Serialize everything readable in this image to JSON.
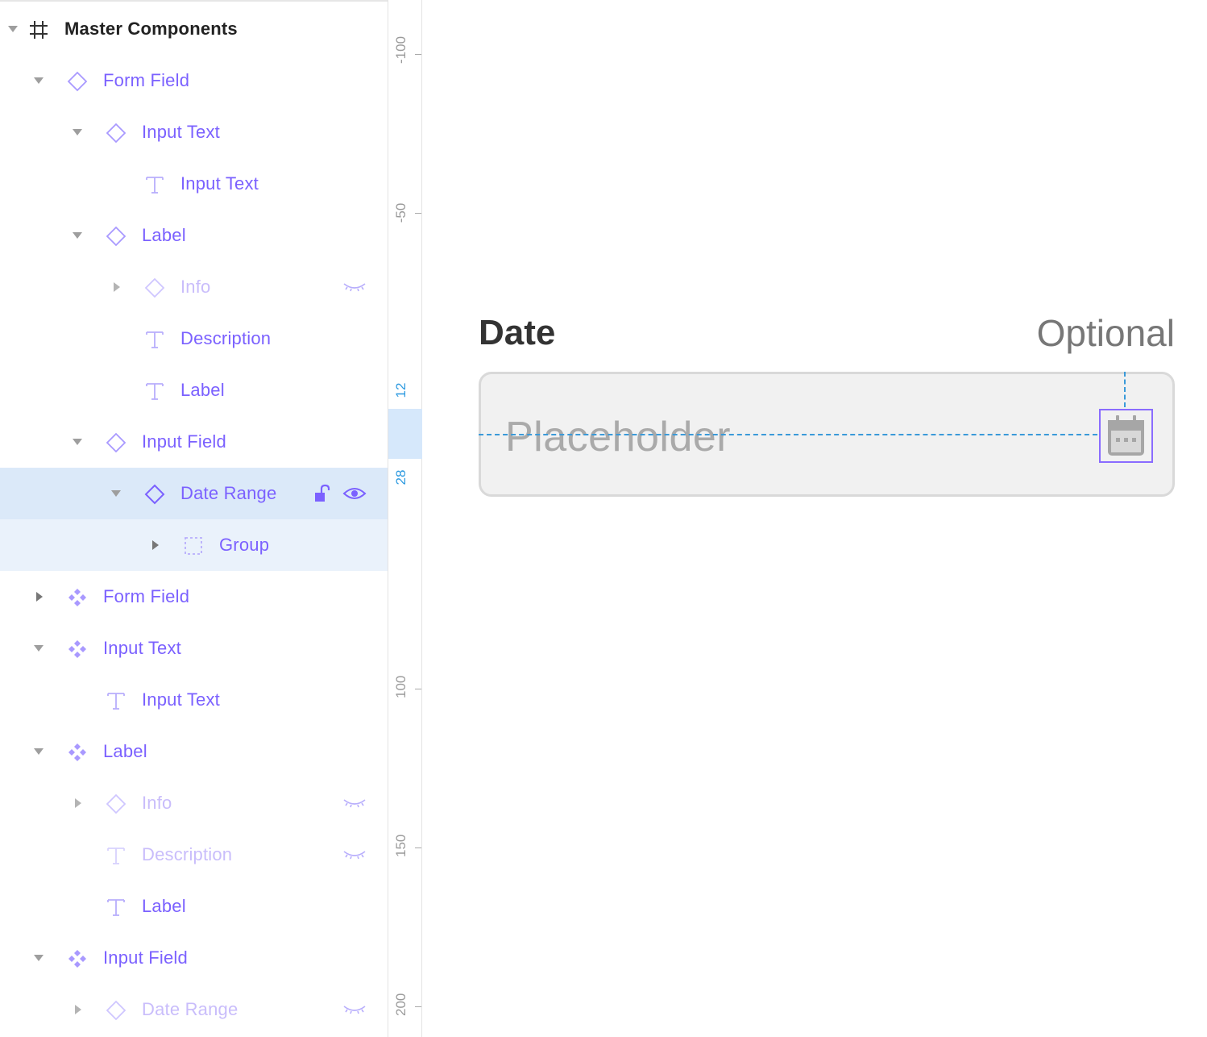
{
  "layers": {
    "root": {
      "label": "Master Components",
      "icon": "frame-icon"
    },
    "items": [
      {
        "label": "Form Field",
        "icon": "component-diamond-icon",
        "caret": "down"
      },
      {
        "label": "Input Text",
        "icon": "component-diamond-icon",
        "caret": "down"
      },
      {
        "label": "Input Text",
        "icon": "text-icon",
        "caret": "none"
      },
      {
        "label": "Label",
        "icon": "component-diamond-icon",
        "caret": "down"
      },
      {
        "label": "Info",
        "icon": "component-diamond-icon",
        "caret": "right",
        "hidden": true
      },
      {
        "label": "Description",
        "icon": "text-icon",
        "caret": "none"
      },
      {
        "label": "Label",
        "icon": "text-icon",
        "caret": "none"
      },
      {
        "label": "Input Field",
        "icon": "component-diamond-icon",
        "caret": "down"
      },
      {
        "label": "Date Range",
        "icon": "component-diamond-icon",
        "caret": "down",
        "selected": true
      },
      {
        "label": "Group",
        "icon": "group-icon",
        "caret": "right"
      },
      {
        "label": "Form Field",
        "icon": "master-component-icon",
        "caret": "right"
      },
      {
        "label": "Input Text",
        "icon": "master-component-icon",
        "caret": "down"
      },
      {
        "label": "Input Text",
        "icon": "text-icon",
        "caret": "none"
      },
      {
        "label": "Label",
        "icon": "master-component-icon",
        "caret": "down"
      },
      {
        "label": "Info",
        "icon": "component-diamond-icon",
        "caret": "right",
        "hidden": true
      },
      {
        "label": "Description",
        "icon": "text-icon",
        "caret": "none",
        "hidden": true
      },
      {
        "label": "Label",
        "icon": "text-icon",
        "caret": "none"
      },
      {
        "label": "Input Field",
        "icon": "master-component-icon",
        "caret": "down"
      },
      {
        "label": "Date Range",
        "icon": "component-diamond-icon",
        "caret": "right",
        "hidden": true
      }
    ]
  },
  "ruler": {
    "ticks": [
      "-100",
      "-50",
      "100",
      "150",
      "200"
    ],
    "selection_start": "12",
    "selection_size": "28"
  },
  "canvas": {
    "label": "Date",
    "optional": "Optional",
    "placeholder": "Placeholder",
    "trailing_icon": "calendar-icon"
  },
  "colors": {
    "accent": "#7b61ff",
    "accent_dim": "#c9bdfb",
    "selection": "#dbe9f9",
    "guide": "#3a9ad9"
  }
}
